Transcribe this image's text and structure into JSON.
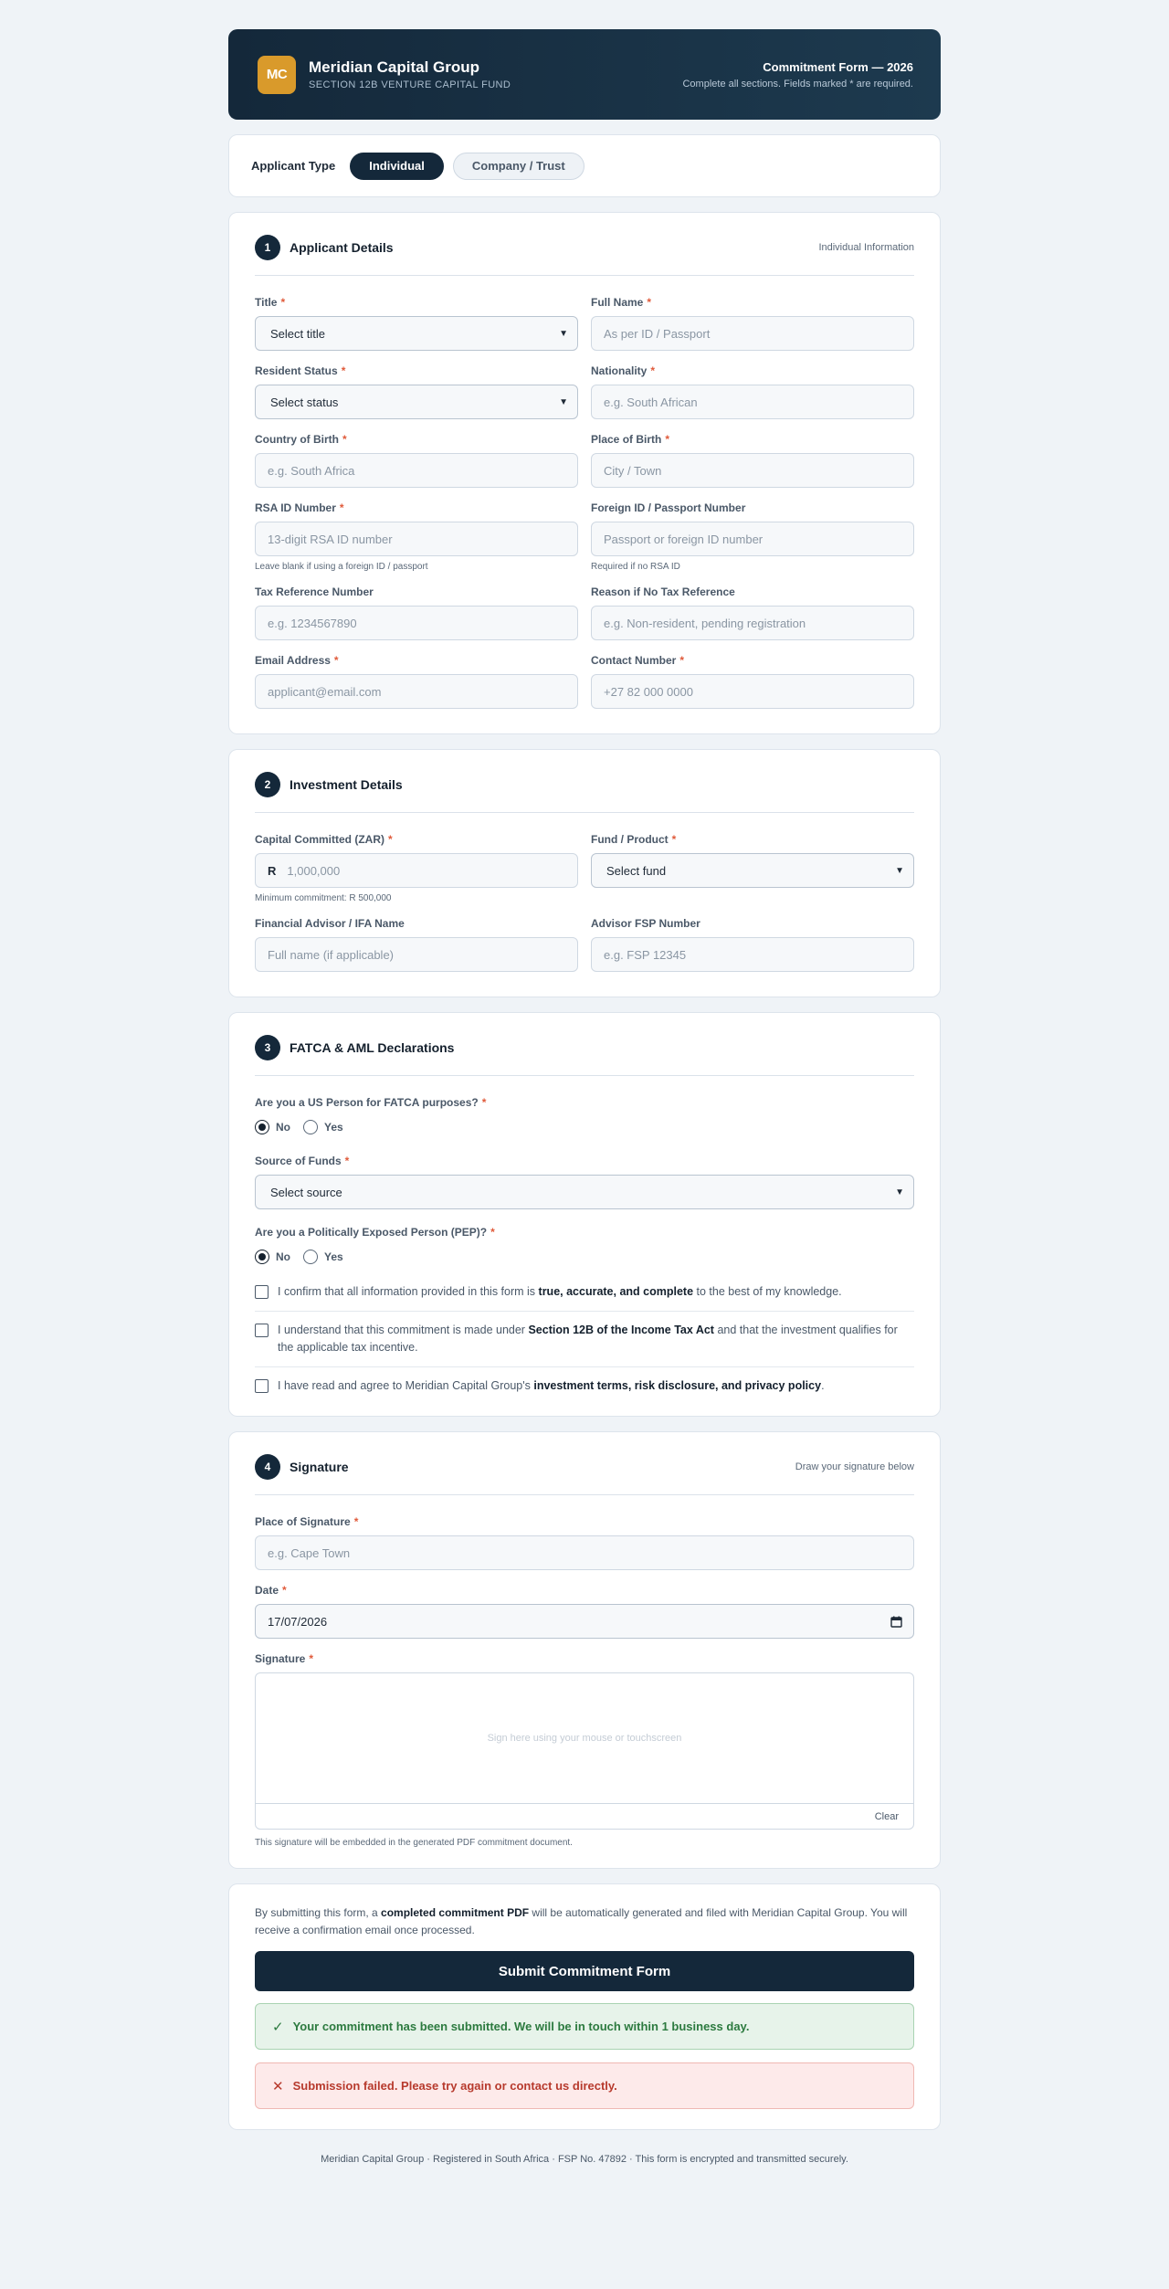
{
  "header": {
    "logo_text": "MC",
    "brand_name": "Meridian Capital Group",
    "brand_sub": "SECTION 12B VENTURE CAPITAL FUND",
    "form_title": "Commitment Form — 2026",
    "form_note": "Complete all sections. Fields marked * are required."
  },
  "applicant_type": {
    "label": "Applicant Type",
    "options": [
      "Individual",
      "Company / Trust"
    ],
    "selected": "Individual"
  },
  "section1": {
    "number": "1",
    "title": "Applicant Details",
    "note": "Individual Information",
    "fields": {
      "title": {
        "label": "Title",
        "value": "Select title"
      },
      "full_name": {
        "label": "Full Name",
        "placeholder": "As per ID / Passport"
      },
      "resident_status": {
        "label": "Resident Status",
        "value": "Select status"
      },
      "nationality": {
        "label": "Nationality",
        "placeholder": "e.g. South African"
      },
      "country_of_birth": {
        "label": "Country of Birth",
        "placeholder": "e.g. South Africa"
      },
      "place_of_birth": {
        "label": "Place of Birth",
        "placeholder": "City / Town"
      },
      "rsa_id": {
        "label": "RSA ID Number",
        "placeholder": "13-digit RSA ID number",
        "help": "Leave blank if using a foreign ID / passport"
      },
      "foreign_id": {
        "label": "Foreign ID / Passport Number",
        "placeholder": "Passport or foreign ID number",
        "help": "Required if no RSA ID"
      },
      "tax_ref": {
        "label": "Tax Reference Number",
        "placeholder": "e.g. 1234567890"
      },
      "no_tax_reason": {
        "label": "Reason if No Tax Reference",
        "placeholder": "e.g. Non-resident, pending registration"
      },
      "email": {
        "label": "Email Address",
        "placeholder": "applicant@email.com"
      },
      "contact": {
        "label": "Contact Number",
        "placeholder": "+27 82 000 0000"
      }
    }
  },
  "section2": {
    "number": "2",
    "title": "Investment Details",
    "fields": {
      "capital": {
        "label": "Capital Committed (ZAR)",
        "prefix": "R",
        "placeholder": "1,000,000",
        "help": "Minimum commitment: R 500,000"
      },
      "fund": {
        "label": "Fund / Product",
        "value": "Select fund"
      },
      "advisor": {
        "label": "Financial Advisor / IFA Name",
        "placeholder": "Full name (if applicable)"
      },
      "fsp": {
        "label": "Advisor FSP Number",
        "placeholder": "e.g. FSP 12345"
      }
    }
  },
  "section3": {
    "number": "3",
    "title": "FATCA & AML Declarations",
    "fatca_q": "Are you a US Person for FATCA purposes?",
    "source_label": "Source of Funds",
    "source_value": "Select source",
    "pep_q": "Are you a Politically Exposed Person (PEP)?",
    "radio_no": "No",
    "radio_yes": "Yes",
    "fatca_selected": "No",
    "pep_selected": "No",
    "checks": [
      {
        "pre": "I confirm that all information provided in this form is ",
        "bold": "true, accurate, and complete",
        "post": " to the best of my knowledge."
      },
      {
        "pre": "I understand that this commitment is made under ",
        "bold": "Section 12B of the Income Tax Act",
        "post": " and that the investment qualifies for the applicable tax incentive."
      },
      {
        "pre": "I have read and agree to Meridian Capital Group's ",
        "bold": "investment terms, risk disclosure, and privacy policy",
        "post": "."
      }
    ]
  },
  "section4": {
    "number": "4",
    "title": "Signature",
    "note": "Draw your signature below",
    "place_label": "Place of Signature",
    "place_placeholder": "e.g. Cape Town",
    "date_label": "Date",
    "date_value": "17/07/2026",
    "sig_label": "Signature",
    "sig_placeholder": "Sign here using your mouse or touchscreen",
    "clear_label": "Clear",
    "sig_help": "This signature will be embedded in the generated PDF commitment document."
  },
  "submit": {
    "note_pre": "By submitting this form, a ",
    "note_bold": "completed commitment PDF",
    "note_post": " will be automatically generated and filed with Meridian Capital Group. You will receive a confirmation email once processed.",
    "button": "Submit Commitment Form",
    "success": "Your commitment has been submitted. We will be in touch within 1 business day.",
    "error": "Submission failed. Please try again or contact us directly."
  },
  "footer": "Meridian Capital Group  ·  Registered in South Africa  ·  FSP No. 47892  ·  This form is encrypted and transmitted securely.",
  "colors": {
    "primary": "#14283a",
    "accent": "#d99a2b",
    "required": "#e05a3a",
    "success": "#2c7a3f",
    "error": "#b73a2d"
  }
}
